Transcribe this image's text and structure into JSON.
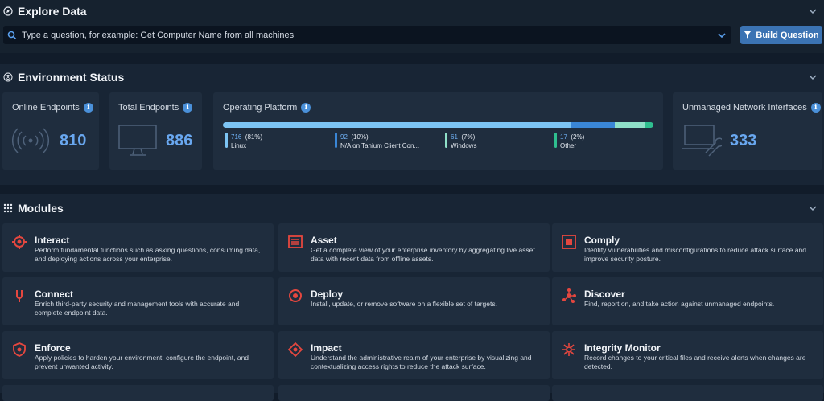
{
  "explore": {
    "title": "Explore Data",
    "search_placeholder": "Type a question, for example: Get Computer Name from all machines",
    "build_label": "Build Question"
  },
  "environment": {
    "title": "Environment Status",
    "online": {
      "label": "Online Endpoints",
      "value": "810"
    },
    "total": {
      "label": "Total Endpoints",
      "value": "886"
    },
    "platform": {
      "label": "Operating Platform",
      "items": [
        {
          "count": "716",
          "pct": "(81%)",
          "name": "Linux",
          "fraction": 0.81,
          "color": "#7cc4f4"
        },
        {
          "count": "92",
          "pct": "(10%)",
          "name": "N/A on Tanium Client Con...",
          "fraction": 0.1,
          "color": "#3a86d6"
        },
        {
          "count": "61",
          "pct": "(7%)",
          "name": "Windows",
          "fraction": 0.07,
          "color": "#8fe0c8"
        },
        {
          "count": "17",
          "pct": "(2%)",
          "name": "Other",
          "fraction": 0.02,
          "color": "#2fbf8f"
        }
      ]
    },
    "unmanaged": {
      "label": "Unmanaged Network Interfaces",
      "value": "333"
    }
  },
  "modules": {
    "title": "Modules",
    "items": [
      {
        "name": "Interact",
        "desc": "Perform fundamental functions such as asking questions, consuming data, and deploying actions across your enterprise.",
        "icon": "interact-icon"
      },
      {
        "name": "Asset",
        "desc": "Get a complete view of your enterprise inventory by aggregating live asset data with recent data from offline assets.",
        "icon": "asset-icon"
      },
      {
        "name": "Comply",
        "desc": "Identify vulnerabilities and misconfigurations to reduce attack surface and improve security posture.",
        "icon": "comply-icon"
      },
      {
        "name": "Connect",
        "desc": "Enrich third-party security and management tools with accurate and complete endpoint data.",
        "icon": "connect-icon"
      },
      {
        "name": "Deploy",
        "desc": "Install, update, or remove software on a flexible set of targets.",
        "icon": "deploy-icon"
      },
      {
        "name": "Discover",
        "desc": "Find, report on, and take action against unmanaged endpoints.",
        "icon": "discover-icon"
      },
      {
        "name": "Enforce",
        "desc": "Apply policies to harden your environment, configure the endpoint, and prevent unwanted activity.",
        "icon": "enforce-icon"
      },
      {
        "name": "Impact",
        "desc": "Understand the administrative realm of your enterprise by visualizing and contextualizing access rights to reduce the attack surface.",
        "icon": "impact-icon"
      },
      {
        "name": "Integrity Monitor",
        "desc": "Record changes to your critical files and receive alerts when changes are detected.",
        "icon": "integrity-monitor-icon"
      }
    ]
  }
}
